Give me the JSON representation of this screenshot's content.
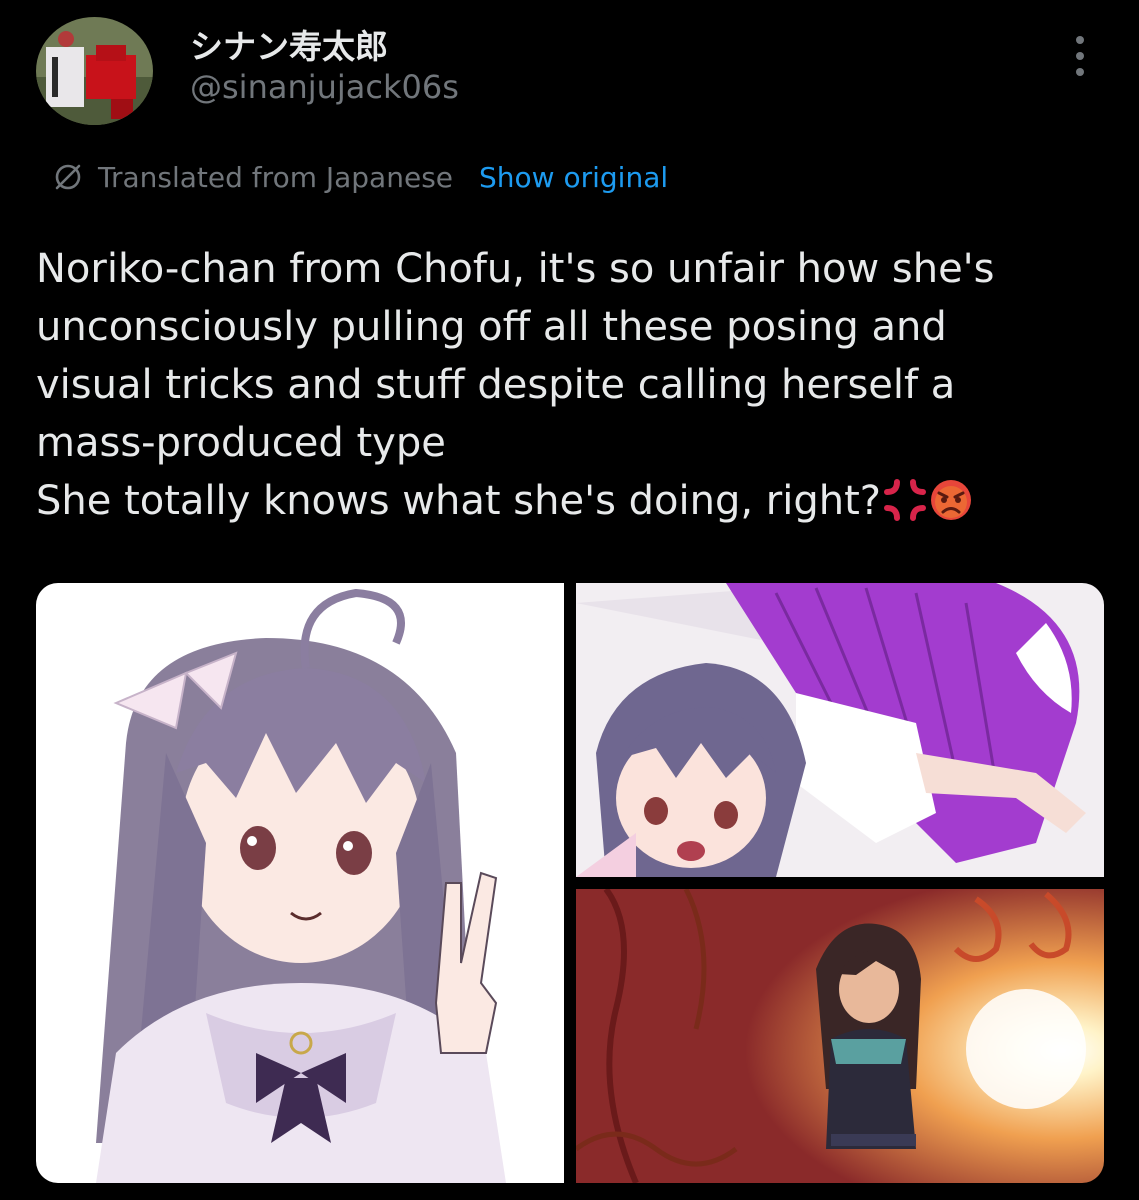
{
  "author": {
    "display_name": "シナン寿太郎",
    "handle": "@sinanjujack06s",
    "avatar_icon": "avatar-photo"
  },
  "translation": {
    "icon": "globe-translate-icon",
    "label": "Translated from Japanese",
    "show_original": "Show original"
  },
  "tweet": {
    "lines": [
      "Noriko-chan from Chofu, it's so unfair how she's",
      "unconsciously pulling off all these posing and",
      "visual tricks and stuff despite calling herself a",
      "mass-produced type",
      "She totally knows what she's doing, right?"
    ],
    "emojis": [
      "anger-symbol-emoji",
      "pouting-face-emoji"
    ]
  },
  "media": {
    "count": 3,
    "images": [
      "anime-girl-peace-sign-image",
      "anime-girl-leaning-image",
      "anime-girl-stage-light-image"
    ]
  },
  "colors": {
    "background": "#000000",
    "text": "#e7e9ea",
    "secondary": "#71767b",
    "link": "#1d9bf0"
  }
}
